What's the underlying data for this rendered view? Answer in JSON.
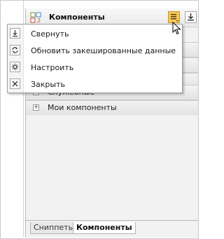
{
  "panel": {
    "title": "Компоненты",
    "icon": "components-grid-icon",
    "header_buttons": [
      {
        "name": "panel-menu-button",
        "icon": "menu-list-icon",
        "active": true
      },
      {
        "name": "collapse-panel-button",
        "icon": "collapse-down-arrow-icon"
      }
    ],
    "sections": [
      {
        "label": "Служебные",
        "expand_icon": "plus-icon"
      },
      {
        "label": "Мои компоненты",
        "expand_icon": "plus-icon"
      }
    ]
  },
  "context_menu": {
    "items": [
      {
        "label": "Свернуть",
        "icon": "collapse-icon"
      },
      {
        "label": "Обновить закешированные данные",
        "icon": "refresh-icon"
      },
      {
        "label": "Настроить",
        "icon": "gear-icon"
      },
      {
        "label": "Закрыть",
        "icon": "close-icon"
      }
    ]
  },
  "tabs": [
    {
      "label": "Сниппеты",
      "active": false
    },
    {
      "label": "Компоненты",
      "active": true
    }
  ],
  "colors": {
    "menu_button_active": "#f6c65a",
    "panel_bg": "#f2f2f2",
    "menu_bg": "#ffffff"
  }
}
